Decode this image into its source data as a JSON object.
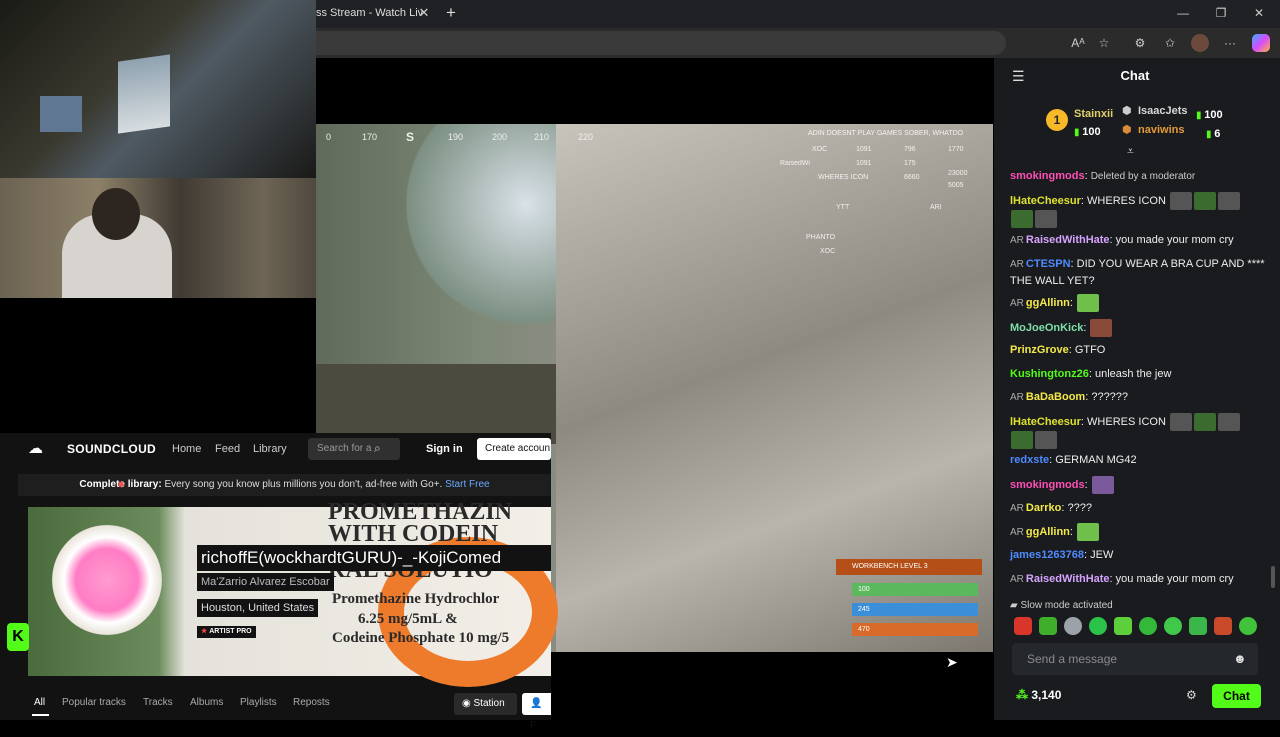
{
  "browser": {
    "tab_title": "ss Stream - Watch Liv",
    "tab_close": "✕",
    "new_tab": "+",
    "window_controls": [
      "—",
      "❐",
      "✕"
    ],
    "toolbar_icons": [
      "read-aloud-icon",
      "favorite-star-icon",
      "extensions-icon",
      "favorites-icon",
      "profile-avatar",
      "more-icon",
      "copilot-icon"
    ]
  },
  "game_hud": {
    "compass": [
      "0",
      "170",
      "S",
      "190",
      "200",
      "210",
      "220"
    ],
    "killfeed": [
      "ADIN DOESNT PLAY GAMES SOBER, WHATDO",
      "XOC",
      "1091",
      "796",
      "1770",
      "RaisedWi",
      "1091",
      "175",
      "23000",
      "WHERES ICON",
      "6660",
      "5005",
      "YTT",
      "ARI",
      "PHANTO",
      "XOC"
    ],
    "workbench_title": "WORKBENCH LEVEL 3",
    "health": "100",
    "water": "245",
    "food": "470"
  },
  "soundcloud": {
    "brand": "SOUNDCLOUD",
    "nav": [
      "Home",
      "Feed",
      "Library"
    ],
    "search_placeholder": "Search for a",
    "sign_in": "Sign in",
    "create_account": "Create accoun",
    "promo_bold": "Complete library:",
    "promo_text": " Every song you know plus millions you don't, ad-free with Go+. ",
    "promo_link": "Start Free",
    "track_title": "richoffE(wockhardtGURU)-_-KojiComed",
    "artist": "Ma'Zarrio Alvarez Escobar",
    "location": "Houston, United States",
    "badge_prefix": "★",
    "badge": "ARTIST PRO",
    "banner_lines": [
      "PROMETHAZIN",
      "WITH CODEIN",
      "RAL SOLUTIO",
      "Promethazine Hydrochlor",
      "6.25 mg/5mL &",
      "Codeine Phosphate 10 mg/5"
    ],
    "tabs": [
      "All",
      "Popular tracks",
      "Tracks",
      "Albums",
      "Playlists",
      "Reposts"
    ],
    "station": "Station",
    "follow": "F"
  },
  "kick_logo": "K",
  "chat": {
    "title": "Chat",
    "leaderboard": [
      {
        "rank": "1",
        "name": "Stainxii",
        "gifts": "100"
      },
      {
        "name": "IsaacJets",
        "gifts": "100"
      },
      {
        "name": "naviwins",
        "gifts": "6"
      }
    ],
    "messages": [
      {
        "user": "smokingmods",
        "color": "#ff4fb5",
        "text": "Deleted by a moderator",
        "deleted": true
      },
      {
        "user": "lHateCheesur",
        "color": "#dfe32f",
        "text": "WHERES ICON"
      },
      {
        "user": "RaisedWithHate",
        "color": "#d6a3ff",
        "text": "you made your mom cry",
        "badge": "AR"
      },
      {
        "user": "CTESPN",
        "color": "#4f8bff",
        "text": "DID YOU WEAR A BRA CUP AND **** THE WALL YET?",
        "badge": "AR"
      },
      {
        "user": "ggAllinn",
        "color": "#f5e94a",
        "text": "",
        "badge": "AR"
      },
      {
        "user": "MoJoeOnKick",
        "color": "#7fe0a8",
        "text": ""
      },
      {
        "user": "PrinzGrove",
        "color": "#f5e94a",
        "text": "GTFO"
      },
      {
        "user": "Kushingtonz26",
        "color": "#53fc18",
        "text": "unleash the jew"
      },
      {
        "user": "BaDaBoom",
        "color": "#f5e94a",
        "text": "??????",
        "badge": "AR"
      },
      {
        "user": "lHateCheesur",
        "color": "#dfe32f",
        "text": "WHERES ICON"
      },
      {
        "user": "redxste",
        "color": "#4f8bff",
        "text": "GERMAN MG42"
      },
      {
        "user": "smokingmods",
        "color": "#ff4fb5",
        "text": ""
      },
      {
        "user": "Darrko",
        "color": "#f5e94a",
        "text": "????",
        "badge": "AR"
      },
      {
        "user": "ggAllinn",
        "color": "#f5e94a",
        "text": "",
        "badge": "AR"
      },
      {
        "user": "james1263768",
        "color": "#4f8bff",
        "text": "JEW"
      },
      {
        "user": "RaisedWithHate",
        "color": "#d6a3ff",
        "text": "you made your mom cry",
        "badge": "AR"
      }
    ],
    "slow_mode": "Slow mode activated",
    "input_placeholder": "Send a message",
    "points": "3,140",
    "send_button": "Chat"
  }
}
